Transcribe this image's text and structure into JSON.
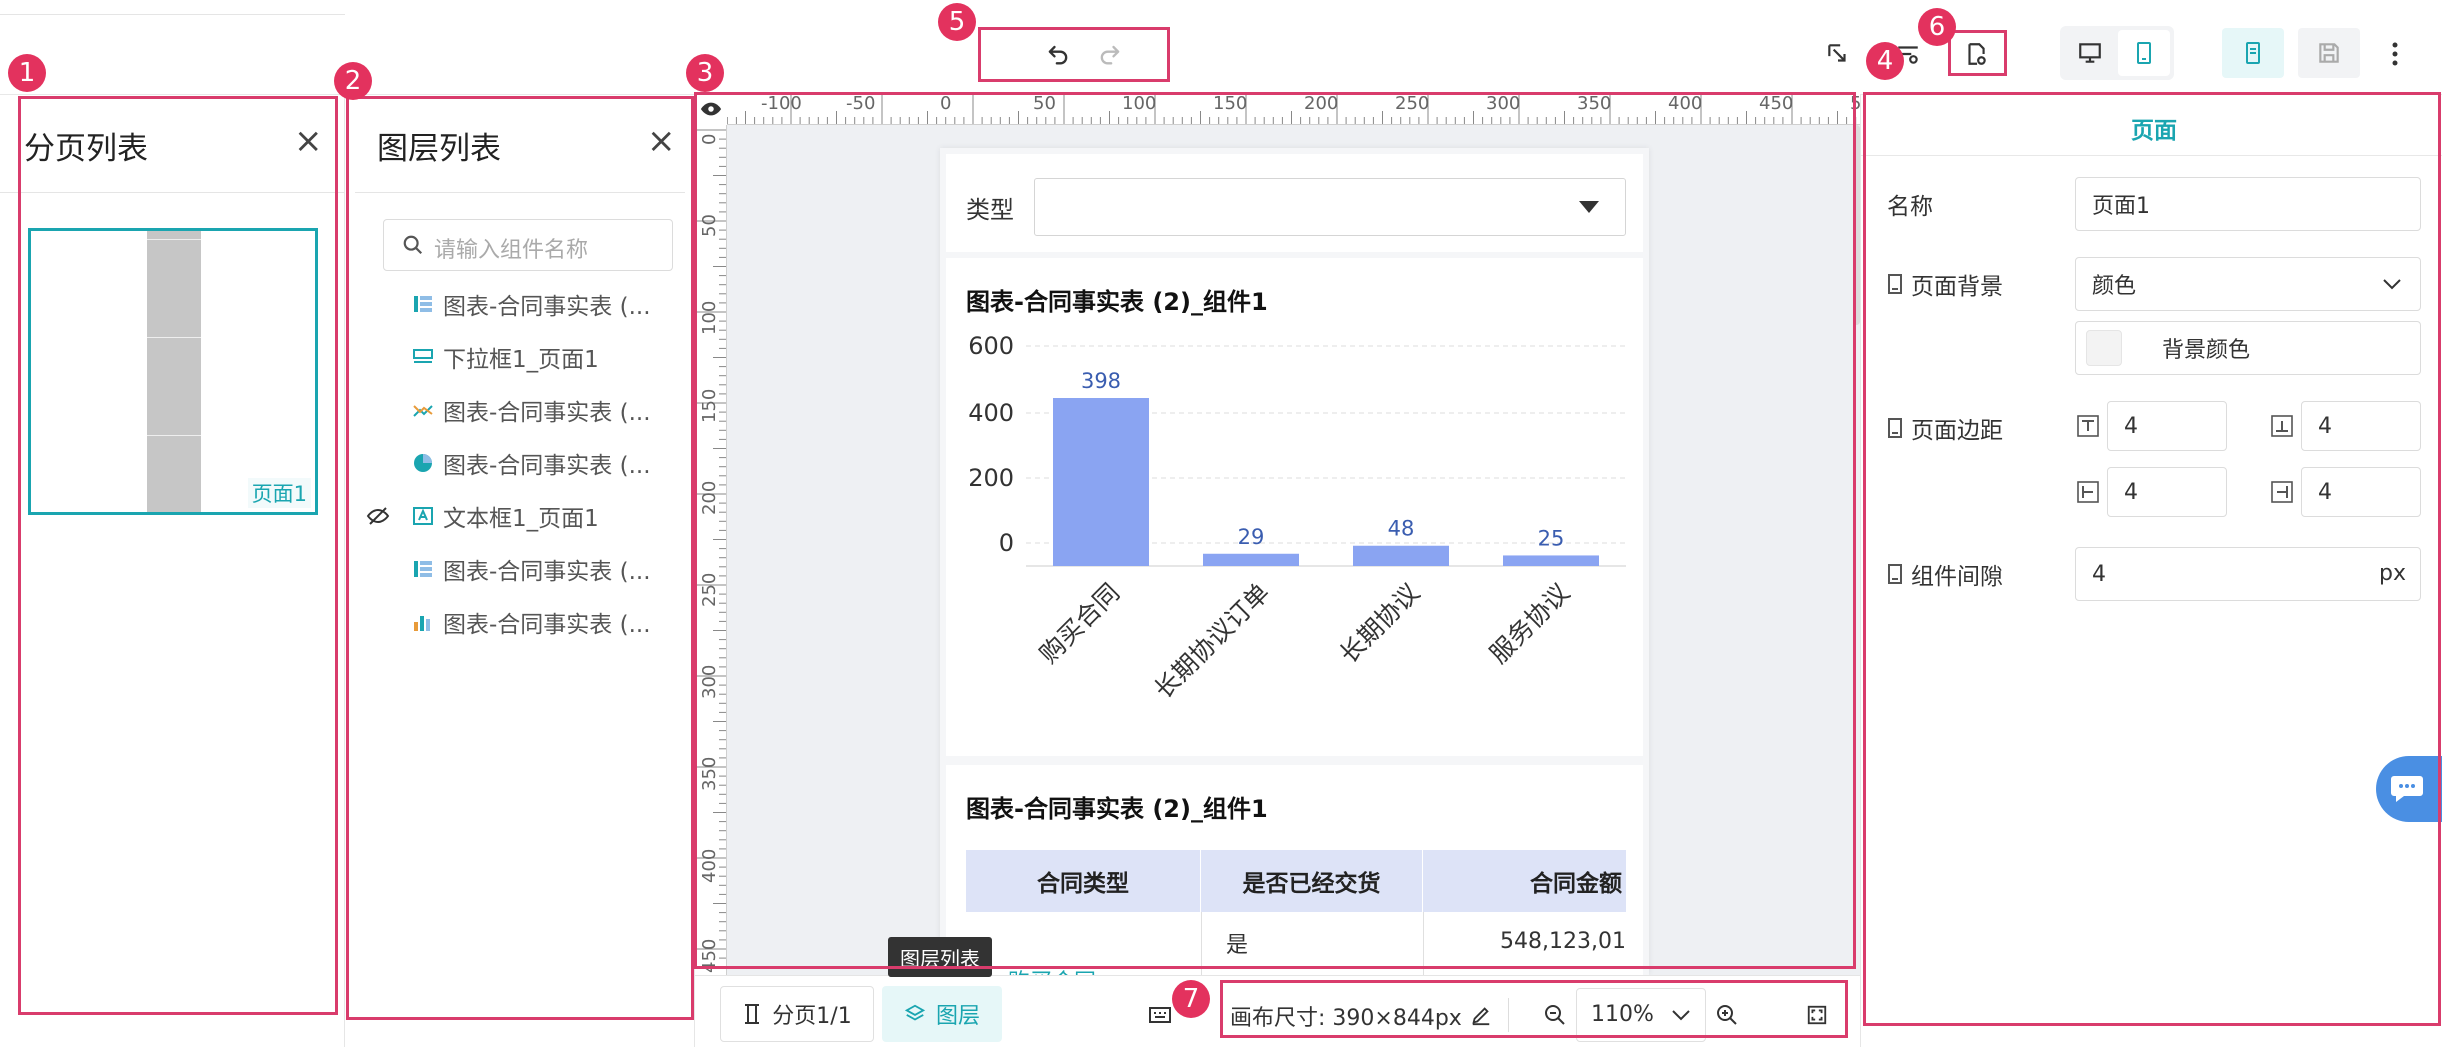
{
  "badges": [
    "1",
    "2",
    "3",
    "4",
    "5",
    "6",
    "7"
  ],
  "page_list": {
    "title": "分页列表",
    "close": "×",
    "thumb_label": "页面1"
  },
  "layer_list": {
    "title": "图层列表",
    "close": "×",
    "search_placeholder": "请输入组件名称",
    "items": [
      {
        "label": "图表-合同事实表 (...",
        "icon": "table-icon"
      },
      {
        "label": "下拉框1_页面1",
        "icon": "dropdown-icon"
      },
      {
        "label": "图表-合同事实表 (...",
        "icon": "line-chart-icon"
      },
      {
        "label": "图表-合同事实表 (...",
        "icon": "pie-chart-icon"
      },
      {
        "label": "文本框1_页面1",
        "icon": "textbox-icon"
      },
      {
        "label": "图表-合同事实表 (...",
        "icon": "table-icon"
      },
      {
        "label": "图表-合同事实表 (...",
        "icon": "bar-chart-icon"
      }
    ]
  },
  "ruler": {
    "h_labels": [
      "-100",
      "-50",
      "0",
      "50",
      "100",
      "150",
      "200",
      "250",
      "300",
      "350",
      "400",
      "450",
      "5"
    ],
    "v_labels": [
      "0",
      "50",
      "100",
      "150",
      "200",
      "250",
      "300",
      "350",
      "400",
      "450"
    ]
  },
  "canvas": {
    "filter_label": "类型",
    "chart_title": "图表-合同事实表 (2)_组件1",
    "table_title": "图表-合同事实表 (2)_组件1",
    "table_headers": [
      "合同类型",
      "是否已经交货",
      "合同金额"
    ],
    "table_row": {
      "col2": "是",
      "col3": "548,123,01"
    },
    "table_partial": "购买合同"
  },
  "chart_data": {
    "type": "bar",
    "categories": [
      "购买合同",
      "长期协议订单",
      "长期协议",
      "服务协议"
    ],
    "values": [
      398,
      29,
      48,
      25
    ],
    "y_ticks": [
      "0",
      "200",
      "400",
      "600"
    ],
    "ylim": [
      0,
      600
    ],
    "bar_color": "#8aa4f2"
  },
  "bottom": {
    "pages_btn": "分页1/1",
    "layers_btn": "图层",
    "tooltip": "图层列表",
    "canvas_size": "画布尺寸: 390×844px",
    "zoom": "110%"
  },
  "props": {
    "tab": "页面",
    "name_label": "名称",
    "name_value": "页面1",
    "bg_label": "页面背景",
    "bg_value": "颜色",
    "bg_color_label": "背景颜色",
    "margin_label": "页面边距",
    "margin_values": [
      "4",
      "4",
      "4",
      "4"
    ],
    "gap_label": "组件间隙",
    "gap_value": "4",
    "gap_unit": "px"
  },
  "colors": {
    "accent": "#1aa5b0",
    "pink": "#d93c6c",
    "bar": "#8aa4f2"
  }
}
